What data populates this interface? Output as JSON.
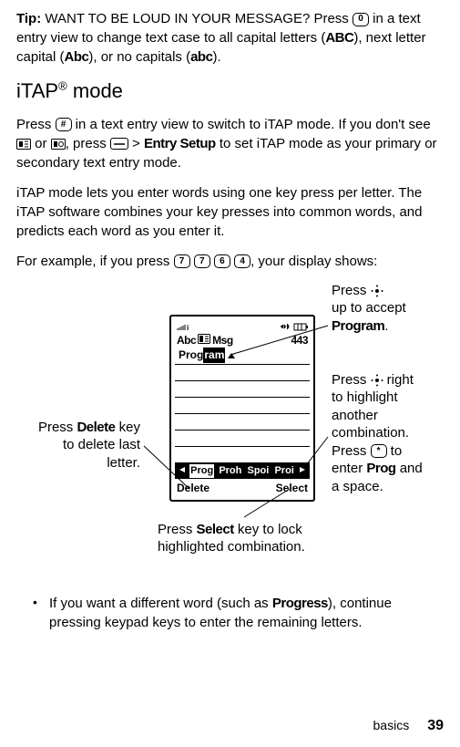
{
  "tip": {
    "label": "Tip:",
    "text1": " WANT TO BE LOUD IN YOUR MESSAGE? Press ",
    "key0": "0",
    "text2": " in a text entry view to change text case to all capital letters (",
    "abc_upper": "ABC",
    "text3": "), next letter capital (",
    "abc_mixed": "Abc",
    "text4": "), or no capitals (",
    "abc_lower": "abc",
    "text5": ")."
  },
  "heading": {
    "main": "iTAP",
    "reg": "®",
    "mode": " mode"
  },
  "p1": {
    "t1": "Press ",
    "hash": "#",
    "t2": " in a text entry view to switch to iTAP mode. If you don't see ",
    "t3": " or ",
    "t4": ", press ",
    "t5": " > ",
    "entry": "Entry Setup",
    "t6": " to set iTAP mode as your primary or secondary text entry mode."
  },
  "p2": "iTAP mode lets you enter words using one key press per letter. The iTAP software combines your key presses into common words, and predicts each word as you enter it.",
  "p3": {
    "t1": "For example, if you press ",
    "k7": "7",
    "k72": "7",
    "k6": "6",
    "k4": "4",
    "t2": ", your display shows:"
  },
  "phone": {
    "abc": "Abc",
    "msg": "Msg",
    "count": "443",
    "word_a": "Prog",
    "word_b": "ram",
    "combo1": "Prog",
    "combo2": "Proh",
    "combo3": "Spoi",
    "combo4": "Proi",
    "soft_left": "Delete",
    "soft_right": "Select"
  },
  "callouts": {
    "up": {
      "l1": "Press ",
      "l2": "up to accept",
      "l3": "Program",
      "l4": "."
    },
    "right": {
      "l1": "Press ",
      "l2": " right",
      "l3": "to highlight",
      "l4": "another",
      "l5": "combination.",
      "l6": "Press ",
      "star": "*",
      "l7": " to",
      "l8": "enter ",
      "prog": "Prog",
      "l9": " and",
      "l10": "a space."
    },
    "delete": {
      "l1": "Press ",
      "del": "Delete",
      "l2": " key",
      "l3": "to delete last",
      "l4": "letter."
    },
    "select": {
      "l1": "Press ",
      "sel": "Select",
      "l2": " key to lock",
      "l3": "highlighted combination."
    }
  },
  "bullet": {
    "t1": "If you want a different word (such as ",
    "progress": "Progress",
    "t2": "), continue pressing keypad keys to enter the remaining letters."
  },
  "footer": {
    "section": "basics",
    "page": "39"
  }
}
